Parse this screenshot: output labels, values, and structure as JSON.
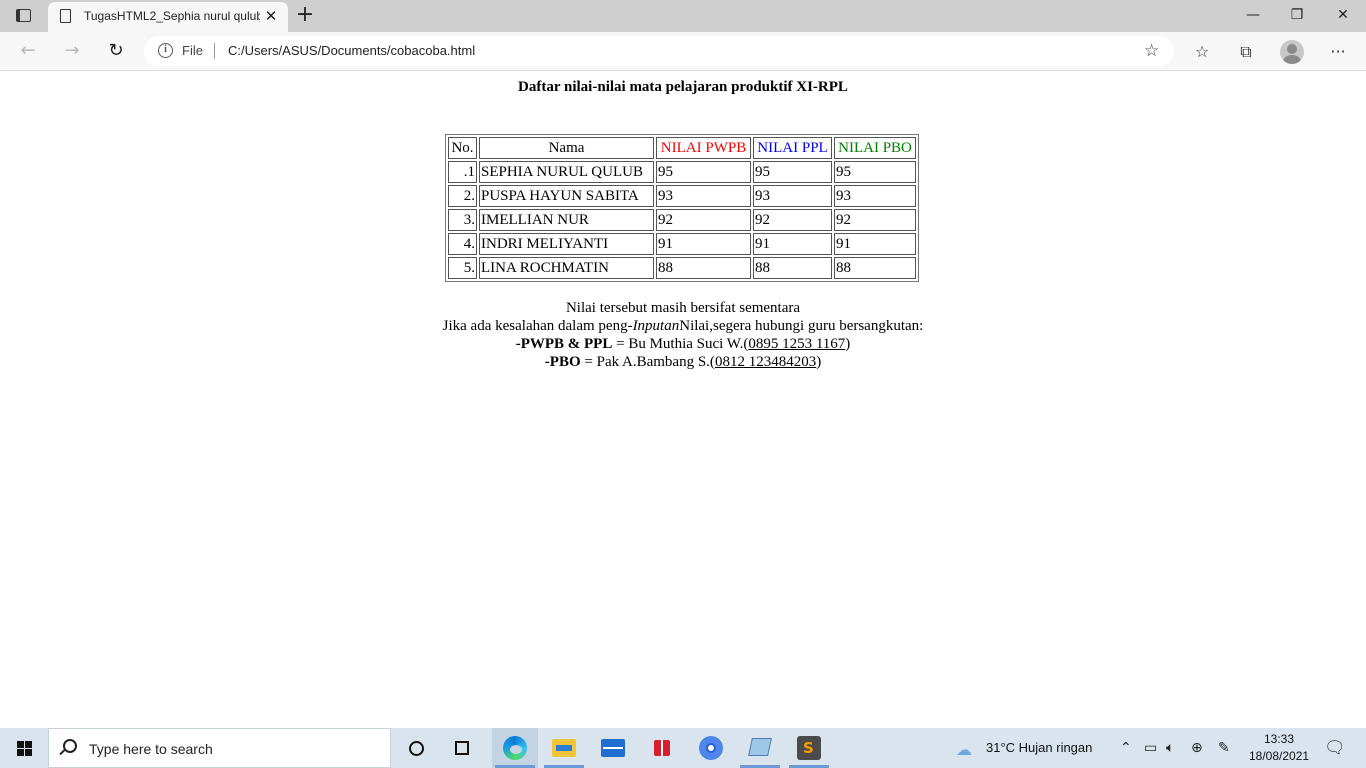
{
  "browser": {
    "tab_title": "TugasHTML2_Sephia nurul qulub",
    "address_label": "File",
    "url": "C:/Users/ASUS/Documents/cobacoba.html"
  },
  "page": {
    "heading": "Daftar nilai-nilai mata pelajaran produktif XI-RPL",
    "table": {
      "headers": [
        "No.",
        "Nama",
        "NILAI PWPB",
        "NILAI PPL",
        "NILAI PBO"
      ],
      "header_colors": [
        "#000000",
        "#000000",
        "#ff0000",
        "#0000ff",
        "#008000"
      ],
      "rows": [
        [
          ".1",
          "SEPHIA NURUL QULUB",
          "95",
          "95",
          "95"
        ],
        [
          "2.",
          "PUSPA HAYUN SABITA",
          "93",
          "93",
          "93"
        ],
        [
          "3.",
          "IMELLIAN NUR",
          "92",
          "92",
          "92"
        ],
        [
          "4.",
          "INDRI MELIYANTI",
          "91",
          "91",
          "91"
        ],
        [
          "5.",
          "LINA ROCHMATIN",
          "88",
          "88",
          "88"
        ]
      ]
    },
    "notes": {
      "line1": "Nilai tersebut masih bersifat sementara",
      "line2_a": "Jika ada kesalahan dalam peng-",
      "line2_italic": "Inputan",
      "line2_b": "Nilai,segera hubungi guru bersangkutan:",
      "contact1_bold": "-PWPB & PPL",
      "contact1_text": " = Bu Muthia Suci W.(",
      "contact1_phone": "0895 1253 1167",
      "contact1_close": ")",
      "contact2_bold": "-PBO",
      "contact2_text": " = Pak A.Bambang S.(",
      "contact2_phone": "0812 123484203",
      "contact2_close": ")"
    }
  },
  "taskbar": {
    "search_placeholder": "Type here to search",
    "weather": "31°C  Hujan ringan",
    "time": "13:33",
    "date": "18/08/2021"
  }
}
